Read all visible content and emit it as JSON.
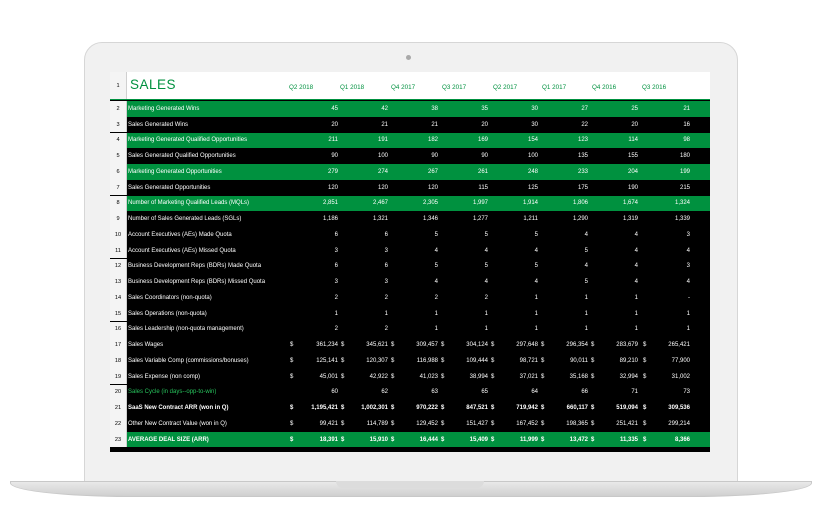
{
  "sheet": {
    "title": "SALES",
    "quarters": [
      "Q2 2018",
      "Q1 2018",
      "Q4 2017",
      "Q3 2017",
      "Q2 2017",
      "Q1 2017",
      "Q4 2016",
      "Q3 2016"
    ],
    "header_row_num": "1",
    "rows": [
      {
        "num": "2",
        "label": "Marketing Generated Wins",
        "values": [
          "45",
          "42",
          "38",
          "35",
          "30",
          "27",
          "25",
          "21"
        ],
        "style": "green",
        "dollar": false
      },
      {
        "num": "3",
        "label": "Sales Generated Wins",
        "values": [
          "20",
          "21",
          "21",
          "20",
          "30",
          "22",
          "20",
          "16"
        ],
        "style": "black",
        "dollar": false
      },
      {
        "num": "4",
        "label": "Marketing Generated Qualified Opportunities",
        "values": [
          "211",
          "191",
          "182",
          "169",
          "154",
          "123",
          "114",
          "98"
        ],
        "style": "green",
        "dollar": false
      },
      {
        "num": "5",
        "label": "Sales Generated Qualified Opportunities",
        "values": [
          "90",
          "100",
          "90",
          "90",
          "100",
          "135",
          "155",
          "180"
        ],
        "style": "black",
        "dollar": false
      },
      {
        "num": "6",
        "label": "Marketing Generated Opportunities",
        "values": [
          "279",
          "274",
          "267",
          "261",
          "248",
          "233",
          "204",
          "199"
        ],
        "style": "green",
        "dollar": false
      },
      {
        "num": "7",
        "label": "Sales Generated Opportunities",
        "values": [
          "120",
          "120",
          "120",
          "115",
          "125",
          "175",
          "190",
          "215"
        ],
        "style": "black",
        "dollar": false
      },
      {
        "num": "8",
        "label": "Number of Marketing Qualified Leads (MQLs)",
        "values": [
          "2,851",
          "2,467",
          "2,305",
          "1,997",
          "1,914",
          "1,806",
          "1,674",
          "1,324"
        ],
        "style": "green",
        "dollar": false
      },
      {
        "num": "9",
        "label": "Number of Sales Generated Leads (SGLs)",
        "values": [
          "1,186",
          "1,321",
          "1,346",
          "1,277",
          "1,211",
          "1,290",
          "1,319",
          "1,339"
        ],
        "style": "black",
        "dollar": false
      },
      {
        "num": "10",
        "label": "Account Executives (AEs) Made Quota",
        "values": [
          "6",
          "6",
          "5",
          "5",
          "5",
          "4",
          "4",
          "3"
        ],
        "style": "black",
        "dollar": false
      },
      {
        "num": "11",
        "label": "Account Executives (AEs) Missed Quota",
        "values": [
          "3",
          "3",
          "4",
          "4",
          "4",
          "5",
          "4",
          "4"
        ],
        "style": "black",
        "dollar": false
      },
      {
        "num": "12",
        "label": "Business Development Reps (BDRs) Made Quota",
        "values": [
          "6",
          "6",
          "5",
          "5",
          "5",
          "4",
          "4",
          "3"
        ],
        "style": "black",
        "dollar": false
      },
      {
        "num": "13",
        "label": "Business Development Reps (BDRs) Missed Quota",
        "values": [
          "3",
          "3",
          "4",
          "4",
          "4",
          "5",
          "4",
          "4"
        ],
        "style": "black",
        "dollar": false
      },
      {
        "num": "14",
        "label": "Sales Coordinators (non-quota)",
        "values": [
          "2",
          "2",
          "2",
          "2",
          "1",
          "1",
          "1",
          "-"
        ],
        "style": "black",
        "dollar": false
      },
      {
        "num": "15",
        "label": "Sales Operations (non-quota)",
        "values": [
          "1",
          "1",
          "1",
          "1",
          "1",
          "1",
          "1",
          "1"
        ],
        "style": "black",
        "dollar": false
      },
      {
        "num": "16",
        "label": "Sales Leadership (non-quota management)",
        "values": [
          "2",
          "2",
          "1",
          "1",
          "1",
          "1",
          "1",
          "1"
        ],
        "style": "black",
        "dollar": false
      },
      {
        "num": "17",
        "label": "Sales Wages",
        "values": [
          "361,234",
          "345,621",
          "309,457",
          "304,124",
          "297,648",
          "296,354",
          "283,679",
          "265,421"
        ],
        "style": "black",
        "dollar": true
      },
      {
        "num": "18",
        "label": "Sales Variable Comp (commissions/bonuses)",
        "values": [
          "125,141",
          "120,307",
          "116,988",
          "109,444",
          "98,721",
          "90,011",
          "89,210",
          "77,900"
        ],
        "style": "black",
        "dollar": true
      },
      {
        "num": "19",
        "label": "Sales Expense (non comp)",
        "values": [
          "45,001",
          "42,922",
          "41,023",
          "38,994",
          "37,021",
          "35,168",
          "32,994",
          "31,002"
        ],
        "style": "black",
        "dollar": true
      },
      {
        "num": "20",
        "label": "Sales Cycle (in days--opp-to-win)",
        "values": [
          "60",
          "62",
          "63",
          "65",
          "64",
          "66",
          "71",
          "73"
        ],
        "style": "black",
        "dollar": false,
        "numgreen": true
      },
      {
        "num": "21",
        "label": "SaaS New Contract ARR (won in Q)",
        "values": [
          "1,195,421",
          "1,002,301",
          "970,222",
          "847,521",
          "719,942",
          "660,117",
          "519,094",
          "309,536"
        ],
        "style": "bold",
        "dollar": true
      },
      {
        "num": "22",
        "label": "Other New Contract Value (won in Q)",
        "values": [
          "99,421",
          "114,789",
          "129,452",
          "151,427",
          "167,452",
          "198,365",
          "251,421",
          "299,214"
        ],
        "style": "black",
        "dollar": true
      },
      {
        "num": "23",
        "label": "AVERAGE DEAL SIZE (ARR)",
        "values": [
          "18,391",
          "15,910",
          "16,444",
          "15,409",
          "11,999",
          "13,472",
          "11,335",
          "8,366"
        ],
        "style": "greenbold",
        "dollar": true
      }
    ],
    "dollar_sign": "$"
  },
  "colors": {
    "accent": "#00913f",
    "background": "#000000",
    "header_bg": "#ffffff"
  }
}
